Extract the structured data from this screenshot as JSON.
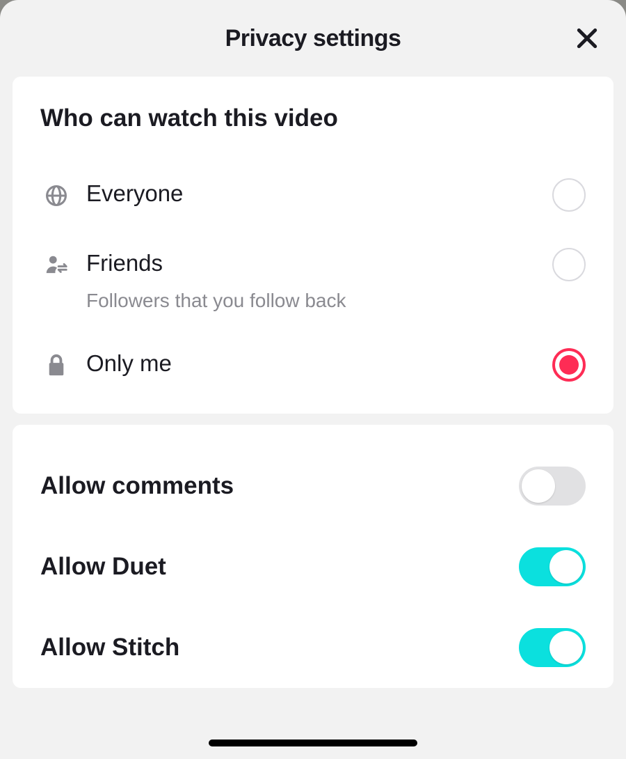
{
  "header": {
    "title": "Privacy settings"
  },
  "visibility": {
    "section_title": "Who can watch this video",
    "options": [
      {
        "label": "Everyone",
        "subtitle": "",
        "selected": false
      },
      {
        "label": "Friends",
        "subtitle": "Followers that you follow back",
        "selected": false
      },
      {
        "label": "Only me",
        "subtitle": "",
        "selected": true
      }
    ]
  },
  "toggles": [
    {
      "label": "Allow comments",
      "on": false
    },
    {
      "label": "Allow Duet",
      "on": true
    },
    {
      "label": "Allow Stitch",
      "on": true
    }
  ],
  "colors": {
    "accent_red": "#fe2c55",
    "accent_teal": "#0be0de",
    "icon_grey": "#8a8a90",
    "bg_grey": "#f2f2f2"
  }
}
